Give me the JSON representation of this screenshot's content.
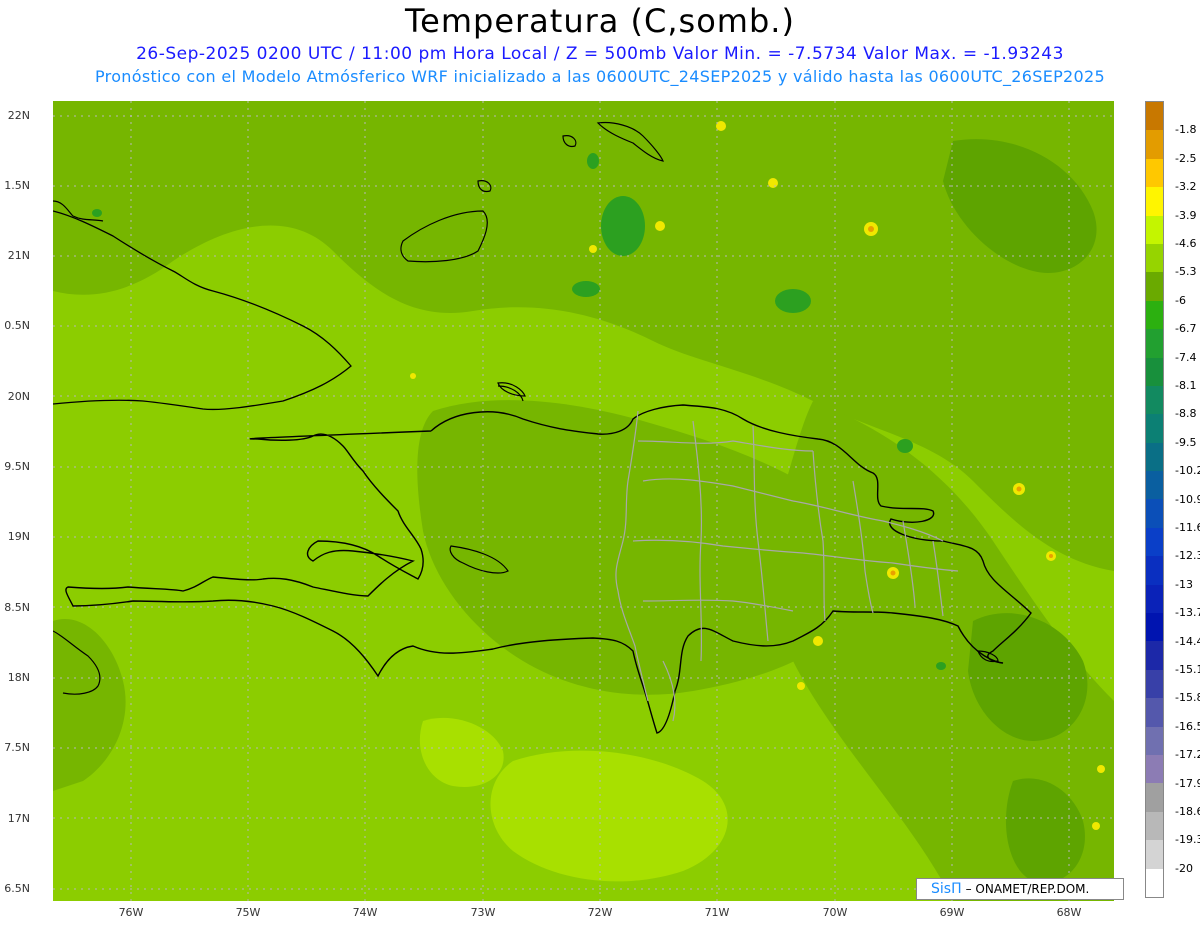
{
  "header": {
    "title": "Temperatura (C,somb.)",
    "subtitle_line1": "26-Sep-2025 0200 UTC / 11:00 pm Hora Local / Z = 500mb  Valor Min. = -7.5734  Valor Max. = -1.93243",
    "subtitle_line2": "Pronóstico con el Modelo Atmósferico WRF inicializado a las 0600UTC_24SEP2025 y válido hasta las  0600UTC_26SEP2025"
  },
  "axes": {
    "lat_labels": [
      "22N",
      "1.5N",
      "21N",
      "0.5N",
      "20N",
      "9.5N",
      "19N",
      "8.5N",
      "18N",
      "7.5N",
      "17N",
      "6.5N"
    ],
    "lon_labels": [
      "76W",
      "75W",
      "74W",
      "73W",
      "72W",
      "71W",
      "70W",
      "69W",
      "68W"
    ]
  },
  "colorbar": {
    "labels": [
      "-1.8",
      "-2.5",
      "-3.2",
      "-3.9",
      "-4.6",
      "-5.3",
      "-6",
      "-6.7",
      "-7.4",
      "-8.1",
      "-8.8",
      "-9.5",
      "-10.2",
      "-10.9",
      "-11.6",
      "-12.3",
      "-13",
      "-13.7",
      "-14.4",
      "-15.1",
      "-15.8",
      "-16.5",
      "-17.2",
      "-17.9",
      "-18.6",
      "-19.3",
      "-20"
    ],
    "colors": [
      "#c87800",
      "#e39c00",
      "#ffc800",
      "#fff500",
      "#c4f500",
      "#96d400",
      "#6aaa00",
      "#2cb010",
      "#22a030",
      "#18903c",
      "#128a60",
      "#0c8074",
      "#0a6f86",
      "#0a5fa0",
      "#0b4fb8",
      "#0a3fc8",
      "#0a2fc0",
      "#0a22b8",
      "#0014b0",
      "#1c28a8",
      "#3840a8",
      "#5458ac",
      "#7070b0",
      "#8c7cb4",
      "#a0a0a0",
      "#b8b8b8",
      "#d4d4d4",
      "#ffffff"
    ]
  },
  "field_colors": {
    "background": "#8ccd00",
    "dark": "#76b600",
    "darker": "#5ea400",
    "light": "#a8e000",
    "spot_green": "#2ca020",
    "spot_yellow": "#f0e800",
    "spot_orange": "#e8a000"
  },
  "credit": {
    "logo": "SisΠ",
    "org": "– ONAMET/REP.DOM."
  }
}
